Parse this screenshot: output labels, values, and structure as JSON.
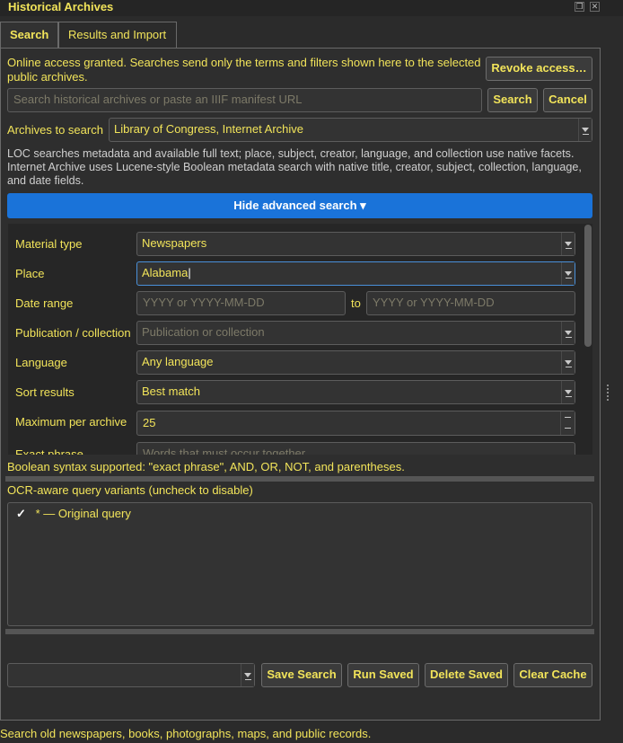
{
  "window": {
    "title": "Historical Archives"
  },
  "tabs": [
    {
      "label": "Search",
      "active": true
    },
    {
      "label": "Results and Import",
      "active": false
    }
  ],
  "access": {
    "message": "Online access granted. Searches send only the terms and filters shown here to the selected public archives.",
    "revoke_label": "Revoke access…"
  },
  "search": {
    "placeholder": "Search historical archives or paste an IIIF manifest URL",
    "value": "",
    "search_label": "Search",
    "cancel_label": "Cancel"
  },
  "archives": {
    "label": "Archives to search",
    "selected": "Library of Congress, Internet Archive"
  },
  "info_text": "LOC searches metadata and available full text; place, subject, creator, language, and collection use native facets. Internet Archive uses Lucene-style Boolean metadata search with native title, creator, subject, collection, language, and date fields.",
  "advanced": {
    "toggle_label": "Hide advanced search ▾",
    "material_type": {
      "label": "Material type",
      "value": "Newspapers"
    },
    "place": {
      "label": "Place",
      "value": "Alabama"
    },
    "date_range": {
      "label": "Date range",
      "from_placeholder": "YYYY or YYYY-MM-DD",
      "to_label": "to",
      "to_placeholder": "YYYY or YYYY-MM-DD"
    },
    "publication": {
      "label": "Publication / collection",
      "placeholder": "Publication or collection"
    },
    "language": {
      "label": "Language",
      "value": "Any language"
    },
    "sort": {
      "label": "Sort results",
      "value": "Best match"
    },
    "max_per_archive": {
      "label": "Maximum per archive",
      "value": "25"
    },
    "exact_phrase": {
      "label": "Exact phrase",
      "placeholder": "Words that must occur together"
    }
  },
  "boolean_hint": "Boolean syntax supported: \"exact phrase\", AND, OR, NOT, and parentheses.",
  "variants": {
    "label": "OCR-aware query variants (uncheck to disable)",
    "items": [
      {
        "check": "✓",
        "text": "* — Original query"
      }
    ]
  },
  "saved": {
    "selected": "",
    "save_label": "Save Search",
    "run_label": "Run Saved",
    "delete_label": "Delete Saved",
    "clear_label": "Clear Cache"
  },
  "status_text": "Search old newspapers, books, photographs, maps, and public records.",
  "colors": {
    "accent": "#1a73d9",
    "text": "#f2e45a",
    "background": "#2b2b2b"
  }
}
